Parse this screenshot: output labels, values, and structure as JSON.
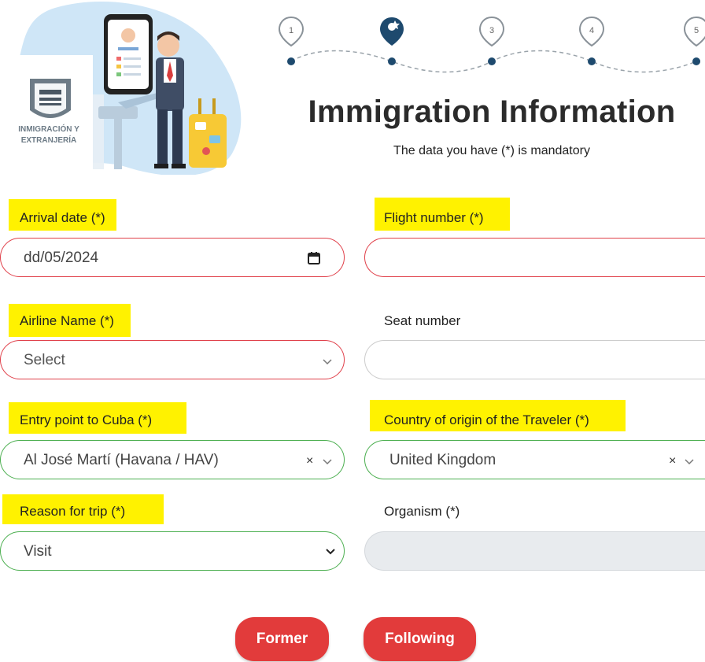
{
  "header": {
    "logo_text_line1": "INMIGRACIÓN Y",
    "logo_text_line2": "EXTRANJERÍA",
    "title": "Immigration Information",
    "subtitle": "The data you have (*) is mandatory"
  },
  "stepper": {
    "steps": [
      "1",
      "",
      "3",
      "4",
      "5"
    ],
    "current_index": 1
  },
  "form": {
    "arrival_date": {
      "label": "Arrival date (*)",
      "value": "dd/05/2024"
    },
    "flight_number": {
      "label": "Flight number (*)",
      "value": ""
    },
    "airline_name": {
      "label": "Airline Name (*)",
      "value": "Select"
    },
    "seat_number": {
      "label": "Seat number",
      "value": ""
    },
    "entry_point": {
      "label": "Entry point to Cuba (*)",
      "value": "Al José Martí (Havana / HAV)"
    },
    "country_origin": {
      "label": "Country of origin of the Traveler (*)",
      "value": "United Kingdom"
    },
    "reason_for_trip": {
      "label": "Reason for trip (*)",
      "value": "Visit"
    },
    "organism": {
      "label": "Organism (*)",
      "value": ""
    }
  },
  "buttons": {
    "former": "Former",
    "following": "Following"
  },
  "colors": {
    "accent_red": "#e23b3b",
    "invalid_border": "#e0404a",
    "valid_border": "#4caf50",
    "highlight": "#fff200",
    "stepper_dot": "#1e4a6e"
  },
  "icons": {
    "date_field": "calendar-icon",
    "dropdown": "chevron-down-icon",
    "clear": "clear-x-icon"
  }
}
